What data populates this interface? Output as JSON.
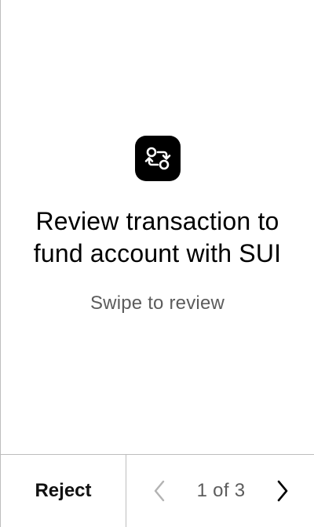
{
  "main": {
    "icon": "swap-arrows-icon",
    "title": "Review transaction to fund account with SUI",
    "subtitle": "Swipe to review"
  },
  "footer": {
    "reject_label": "Reject",
    "page_indicator": "1 of 3",
    "prev_icon": "chevron-left-icon",
    "next_icon": "chevron-right-icon",
    "current_page": 1,
    "total_pages": 3
  },
  "colors": {
    "background": "#ffffff",
    "icon_background": "#000000",
    "primary_text": "#000000",
    "secondary_text": "#5c5c5c",
    "divider": "#bdbdbd",
    "disabled_chevron": "#b3b3b3"
  }
}
